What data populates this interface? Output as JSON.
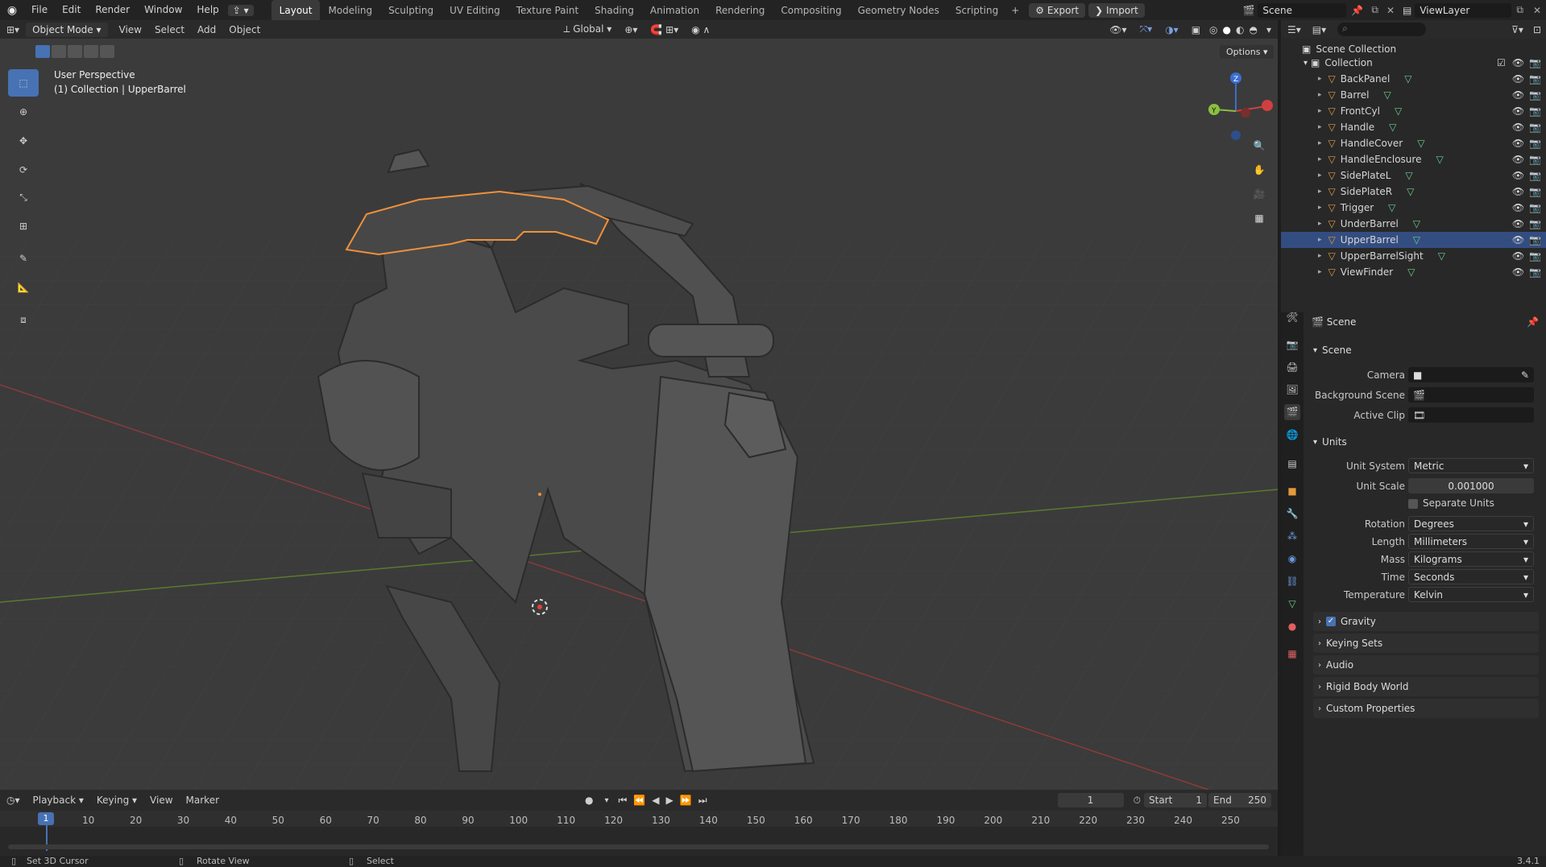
{
  "topbar": {
    "menus": [
      "File",
      "Edit",
      "Render",
      "Window",
      "Help"
    ],
    "workspaces": [
      "Layout",
      "Modeling",
      "Sculpting",
      "UV Editing",
      "Texture Paint",
      "Shading",
      "Animation",
      "Rendering",
      "Compositing",
      "Geometry Nodes",
      "Scripting"
    ],
    "active_workspace": "Layout",
    "export_label": "Export",
    "import_label": "Import",
    "scene_name": "Scene",
    "view_layer": "ViewLayer"
  },
  "viewport_header": {
    "mode": "Object Mode",
    "menus": [
      "View",
      "Select",
      "Add",
      "Object"
    ],
    "transform_orientation": "Global",
    "options_label": "Options"
  },
  "viewport": {
    "perspective_label": "User Perspective",
    "context_label": "(1) Collection | UpperBarrel",
    "selection_color": "#f0903a"
  },
  "outliner": {
    "root": "Scene Collection",
    "collection": "Collection",
    "items": [
      "BackPanel",
      "Barrel",
      "FrontCyl",
      "Handle",
      "HandleCover",
      "HandleEnclosure",
      "SidePlateL",
      "SidePlateR",
      "Trigger",
      "UnderBarrel",
      "UpperBarrel",
      "UpperBarrelSight",
      "ViewFinder"
    ],
    "selected": "UpperBarrel"
  },
  "properties": {
    "context": "Scene",
    "scene_panel": {
      "title": "Scene",
      "camera_label": "Camera",
      "background_scene_label": "Background Scene",
      "active_clip_label": "Active Clip"
    },
    "units_panel": {
      "title": "Units",
      "unit_system_label": "Unit System",
      "unit_system": "Metric",
      "unit_scale_label": "Unit Scale",
      "unit_scale": "0.001000",
      "separate_units_label": "Separate Units",
      "rotation_label": "Rotation",
      "rotation": "Degrees",
      "length_label": "Length",
      "length": "Millimeters",
      "mass_label": "Mass",
      "mass": "Kilograms",
      "time_label": "Time",
      "time": "Seconds",
      "temperature_label": "Temperature",
      "temperature": "Kelvin"
    },
    "collapsed_panels": [
      "Gravity",
      "Keying Sets",
      "Audio",
      "Rigid Body World",
      "Custom Properties"
    ]
  },
  "timeline": {
    "menus": [
      "Playback",
      "Keying",
      "View",
      "Marker"
    ],
    "current_frame": "1",
    "start_label": "Start",
    "start": "1",
    "end_label": "End",
    "end": "250",
    "ticks": [
      "1",
      "10",
      "20",
      "30",
      "40",
      "50",
      "60",
      "70",
      "80",
      "90",
      "100",
      "110",
      "120",
      "130",
      "140",
      "150",
      "160",
      "170",
      "180",
      "190",
      "200",
      "210",
      "220",
      "230",
      "240",
      "250"
    ]
  },
  "status": {
    "hint1": "Set 3D Cursor",
    "hint2": "Rotate View",
    "hint3": "Select",
    "version": "3.4.1"
  }
}
